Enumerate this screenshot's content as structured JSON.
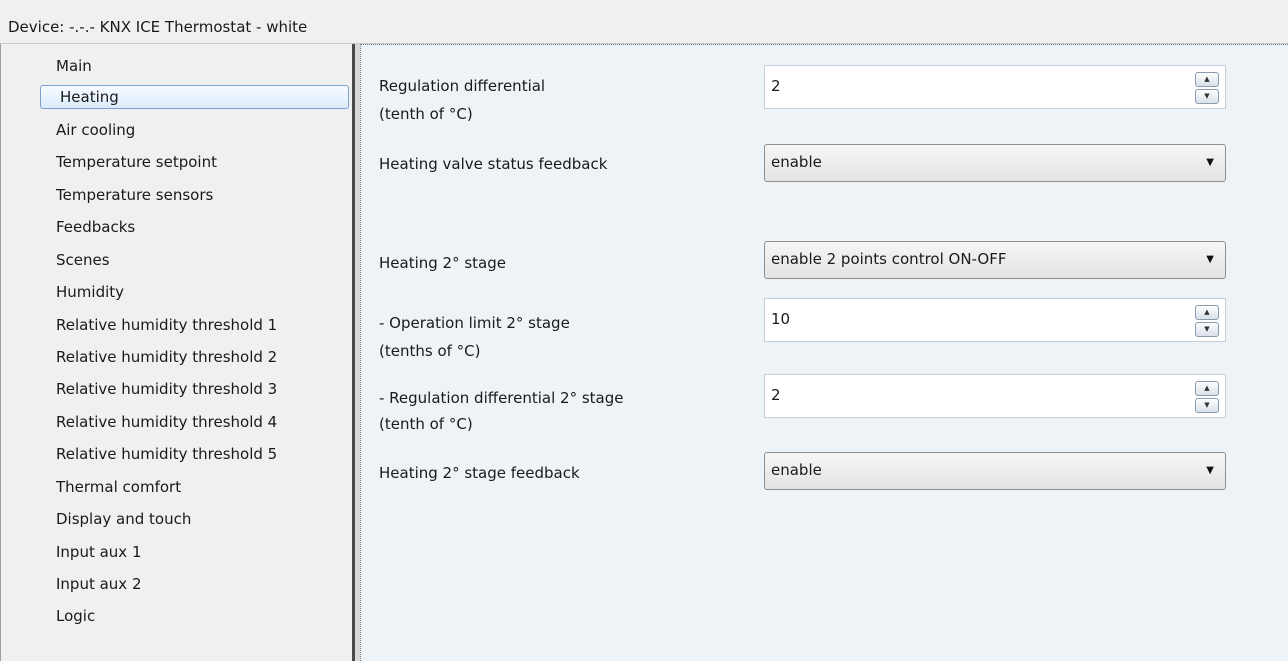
{
  "title": "Device: -.-.-  KNX ICE Thermostat - white",
  "sidebar": {
    "items": [
      {
        "label": "Main"
      },
      {
        "label": "Heating"
      },
      {
        "label": "Air cooling"
      },
      {
        "label": "Temperature setpoint"
      },
      {
        "label": "Temperature sensors"
      },
      {
        "label": "Feedbacks"
      },
      {
        "label": "Scenes"
      },
      {
        "label": "Humidity"
      },
      {
        "label": "Relative humidity threshold 1"
      },
      {
        "label": "Relative humidity threshold 2"
      },
      {
        "label": "Relative humidity threshold 3"
      },
      {
        "label": "Relative humidity threshold 4"
      },
      {
        "label": "Relative humidity threshold 5"
      },
      {
        "label": "Thermal comfort"
      },
      {
        "label": "Display and touch"
      },
      {
        "label": "Input aux 1"
      },
      {
        "label": "Input aux 2"
      },
      {
        "label": "Logic"
      }
    ],
    "selected": "Heating"
  },
  "params": {
    "reg_diff": {
      "label1": "Regulation differential",
      "label2": " (tenth of °C)",
      "value": "2"
    },
    "valve_fb": {
      "label": "Heating valve status feedback",
      "value": "enable"
    },
    "stage2": {
      "label": "Heating 2° stage",
      "value": "enable 2 points control ON-OFF"
    },
    "op_limit": {
      "label1": "- Operation limit 2° stage",
      "label2": " (tenths of °C)",
      "value": "10"
    },
    "reg_diff2": {
      "label1": "- Regulation differential 2° stage",
      "label2": " (tenth of °C)",
      "value": "2"
    },
    "stage2_fb": {
      "label": "Heating 2° stage feedback",
      "value": "enable"
    }
  },
  "icons": {
    "spin_up": "triangle-up-icon",
    "spin_down": "triangle-down-icon",
    "dropdown": "chevron-down-icon"
  },
  "colors": {
    "selection_border": "#7da2ce",
    "panel_bg": "#eef3f8",
    "sidebar_bg": "#f0f0f0"
  }
}
